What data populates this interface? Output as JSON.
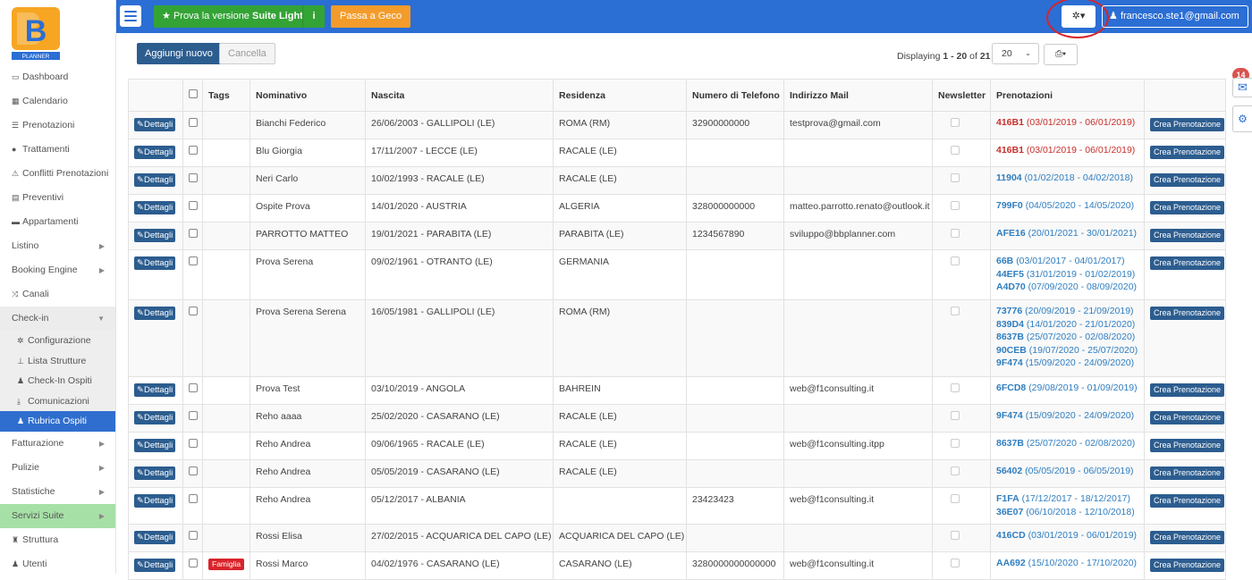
{
  "app": {
    "logo_text": "PLANNER",
    "user_label": "francesco.ste1@gmail.com",
    "suite_prefix": "Prova la versione",
    "suite_bold": "Suite Light",
    "geco_label": "Passa a Geco",
    "mail_count": "14"
  },
  "sidebar": {
    "items": [
      {
        "label": "Dashboard",
        "icon": "▭"
      },
      {
        "label": "Calendario",
        "icon": "▦"
      },
      {
        "label": "Prenotazioni",
        "icon": "☰"
      },
      {
        "label": "Trattamenti",
        "icon": "●"
      },
      {
        "label": "Conflitti Prenotazioni",
        "icon": "⚠"
      },
      {
        "label": "Preventivi",
        "icon": "▤"
      },
      {
        "label": "Appartamenti",
        "icon": "▬"
      },
      {
        "label": "Listino",
        "icon": ""
      },
      {
        "label": "Booking Engine",
        "icon": ""
      },
      {
        "label": "Canali",
        "icon": "⤨"
      },
      {
        "label": "Check-in",
        "icon": ""
      },
      {
        "label": "Configurazione",
        "icon": "✲"
      },
      {
        "label": "Lista Strutture",
        "icon": "⊥"
      },
      {
        "label": "Check-In Ospiti",
        "icon": "♟"
      },
      {
        "label": "Comunicazioni",
        "icon": "⤓"
      },
      {
        "label": "Rubrica Ospiti",
        "icon": "♟"
      },
      {
        "label": "Fatturazione",
        "icon": ""
      },
      {
        "label": "Pulizie",
        "icon": ""
      },
      {
        "label": "Statistiche",
        "icon": ""
      },
      {
        "label": "Servizi Suite",
        "icon": ""
      },
      {
        "label": "Struttura",
        "icon": "♜"
      },
      {
        "label": "Utenti",
        "icon": "♟"
      }
    ]
  },
  "toolbar": {
    "add_label": "Aggiungi nuovo",
    "delete_label": "Cancella",
    "displaying_prefix": "Displaying",
    "range": "1 - 20",
    "of_label": "of",
    "total": "21",
    "per_page": "20"
  },
  "table": {
    "headers": [
      "Tags",
      "Nominativo",
      "Nascita",
      "Residenza",
      "Numero di Telefono",
      "Indirizzo Mail",
      "Newsletter",
      "Prenotazioni"
    ],
    "detail_label": "Dettagli",
    "create_label": "Crea Prenotazione",
    "rows": [
      {
        "tag": "",
        "name": "Bianchi Federico",
        "birth": "26/06/2003 - GALLIPOLI (LE)",
        "res": "ROMA (RM)",
        "phone": "32900000000",
        "mail": "testprova@gmail.com",
        "pren": [
          {
            "code": "416B1",
            "dates": "(03/01/2019 - 06/01/2019)",
            "red": true
          }
        ]
      },
      {
        "tag": "",
        "name": "Blu Giorgia",
        "birth": "17/11/2007 - LECCE (LE)",
        "res": "RACALE (LE)",
        "phone": "",
        "mail": "",
        "pren": [
          {
            "code": "416B1",
            "dates": "(03/01/2019 - 06/01/2019)",
            "red": true
          }
        ]
      },
      {
        "tag": "",
        "name": "Neri Carlo",
        "birth": "10/02/1993 - RACALE (LE)",
        "res": "RACALE (LE)",
        "phone": "",
        "mail": "",
        "pren": [
          {
            "code": "11904",
            "dates": "(01/02/2018 - 04/02/2018)",
            "red": false
          }
        ]
      },
      {
        "tag": "",
        "name": "Ospite Prova",
        "birth": "14/01/2020 - AUSTRIA",
        "res": "ALGERIA",
        "phone": "328000000000",
        "mail": "matteo.parrotto.renato@outlook.it",
        "pren": [
          {
            "code": "799F0",
            "dates": "(04/05/2020 - 14/05/2020)",
            "red": false
          }
        ]
      },
      {
        "tag": "",
        "name": "PARROTTO MATTEO",
        "birth": "19/01/2021 - PARABITA (LE)",
        "res": "PARABITA (LE)",
        "phone": "1234567890",
        "mail": "sviluppo@bbplanner.com",
        "pren": [
          {
            "code": "AFE16",
            "dates": "(20/01/2021 - 30/01/2021)",
            "red": false
          }
        ]
      },
      {
        "tag": "",
        "name": "Prova Serena",
        "birth": "09/02/1961 - OTRANTO (LE)",
        "res": "GERMANIA",
        "phone": "",
        "mail": "",
        "pren": [
          {
            "code": "66B",
            "dates": "(03/01/2017 - 04/01/2017)",
            "red": false
          },
          {
            "code": "44EF5",
            "dates": "(31/01/2019 - 01/02/2019)",
            "red": false
          },
          {
            "code": "A4D70",
            "dates": "(07/09/2020 - 08/09/2020)",
            "red": false
          }
        ]
      },
      {
        "tag": "",
        "name": "Prova Serena Serena",
        "birth": "16/05/1981 - GALLIPOLI (LE)",
        "res": "ROMA (RM)",
        "phone": "",
        "mail": "",
        "pren": [
          {
            "code": "73776",
            "dates": "(20/09/2019 - 21/09/2019)",
            "red": false
          },
          {
            "code": "839D4",
            "dates": "(14/01/2020 - 21/01/2020)",
            "red": false
          },
          {
            "code": "8637B",
            "dates": "(25/07/2020 - 02/08/2020)",
            "red": false
          },
          {
            "code": "90CEB",
            "dates": "(19/07/2020 - 25/07/2020)",
            "red": false
          },
          {
            "code": "9F474",
            "dates": "(15/09/2020 - 24/09/2020)",
            "red": false
          }
        ]
      },
      {
        "tag": "",
        "name": "Prova Test",
        "birth": "03/10/2019 - ANGOLA",
        "res": "BAHREIN",
        "phone": "",
        "mail": "web@f1consulting.it",
        "pren": [
          {
            "code": "6FCD8",
            "dates": "(29/08/2019 - 01/09/2019)",
            "red": false
          }
        ]
      },
      {
        "tag": "",
        "name": "Reho aaaa",
        "birth": "25/02/2020 - CASARANO (LE)",
        "res": "RACALE (LE)",
        "phone": "",
        "mail": "",
        "pren": [
          {
            "code": "9F474",
            "dates": "(15/09/2020 - 24/09/2020)",
            "red": false
          }
        ]
      },
      {
        "tag": "",
        "name": "Reho Andrea",
        "birth": "09/06/1965 - RACALE (LE)",
        "res": "RACALE (LE)",
        "phone": "",
        "mail": "web@f1consulting.itpp",
        "pren": [
          {
            "code": "8637B",
            "dates": "(25/07/2020 - 02/08/2020)",
            "red": false
          }
        ]
      },
      {
        "tag": "",
        "name": "Reho Andrea",
        "birth": "05/05/2019 - CASARANO (LE)",
        "res": "RACALE (LE)",
        "phone": "",
        "mail": "",
        "pren": [
          {
            "code": "56402",
            "dates": "(05/05/2019 - 06/05/2019)",
            "red": false
          }
        ]
      },
      {
        "tag": "",
        "name": "Reho Andrea",
        "birth": "05/12/2017 - ALBANIA",
        "res": "",
        "phone": "23423423",
        "mail": "web@f1consulting.it",
        "pren": [
          {
            "code": "F1FA",
            "dates": "(17/12/2017 - 18/12/2017)",
            "red": false
          },
          {
            "code": "36E07",
            "dates": "(06/10/2018 - 12/10/2018)",
            "red": false
          }
        ]
      },
      {
        "tag": "",
        "name": "Rossi Elisa",
        "birth": "27/02/2015 - ACQUARICA DEL CAPO (LE)",
        "res": "ACQUARICA DEL CAPO (LE)",
        "phone": "",
        "mail": "",
        "pren": [
          {
            "code": "416CD",
            "dates": "(03/01/2019 - 06/01/2019)",
            "red": false
          }
        ]
      },
      {
        "tag": "Famiglia",
        "name": "Rossi Marco",
        "birth": "04/02/1976 - CASARANO (LE)",
        "res": "CASARANO (LE)",
        "phone": "3280000000000000",
        "mail": "web@f1consulting.it",
        "pren": [
          {
            "code": "AA692",
            "dates": "(15/10/2020 - 17/10/2020)",
            "red": false
          }
        ]
      }
    ]
  }
}
